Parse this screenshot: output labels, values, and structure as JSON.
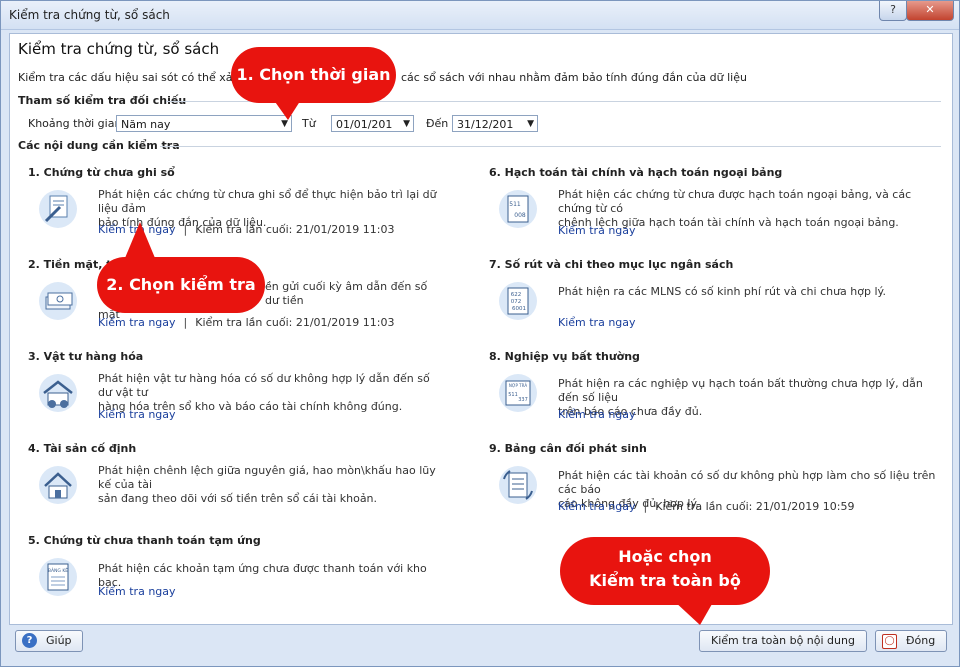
{
  "window": {
    "title": "Kiểm tra chứng từ, sổ sách",
    "help_glyph": "?",
    "close_glyph": "✕"
  },
  "header": {
    "title": "Kiểm tra chứng từ, sổ sách",
    "description_left": "Kiểm tra các dấu hiệu sai sót có thể xảy ra trong",
    "description_right": "các sổ sách với nhau nhằm đảm bảo tính đúng đắn của dữ liệu"
  },
  "params": {
    "section_title": "Tham số kiểm tra đối chiếu",
    "period_label": "Khoảng thời gian",
    "period_value": "Năm nay",
    "from_label": "Từ",
    "from_value": "01/01/201",
    "to_label": "Đến",
    "to_value": "31/12/201"
  },
  "content": {
    "section_title": "Các nội dung cần kiểm tra",
    "check_now": "Kiểm tra ngay",
    "items": [
      {
        "title": "1. Chứng từ chưa ghi sổ",
        "desc1": "Phát hiện các chứng từ chưa ghi sổ để thực hiện bảo trì lại dữ liệu đảm",
        "desc2": "bảo tính đúng đắn của dữ liệu.",
        "last_check": "Kiểm tra lần cuối: 21/01/2019 11:03",
        "icon": "document-pen-icon"
      },
      {
        "title": "2. Tiền mặt, tiề",
        "desc1": "ền gửi cuối kỳ âm dẫn đến số dư tiền",
        "desc2": "mặt",
        "last_check": "Kiểm tra lần cuối: 21/01/2019 11:03",
        "icon": "cash-icon"
      },
      {
        "title": "3. Vật tư hàng hóa",
        "desc1": "Phát hiện vật tư hàng hóa có số dư không hợp lý dẫn đến số dư vật tư",
        "desc2": "hàng hóa trên sổ kho và báo cáo tài chính không đúng.",
        "last_check": "",
        "icon": "warehouse-icon"
      },
      {
        "title": "4. Tài sản cố định",
        "desc1": "Phát hiện chênh lệch giữa nguyên giá, hao mòn\\khấu hao lũy kế của tài",
        "desc2": "sản đang theo dõi với số tiền trên sổ cái tài khoản.",
        "last_check": "",
        "icon": "house-icon"
      },
      {
        "title": "5. Chứng từ chưa thanh toán tạm ứng",
        "desc1": "Phát hiện các khoản tạm ứng chưa được thanh toán với kho bạc.",
        "desc2": "",
        "last_check": "",
        "icon": "report-icon"
      },
      {
        "title": "6. Hạch toán tài chính và hạch toán ngoại bảng",
        "desc1": "Phát hiện các chứng từ chưa được hạch toán ngoại bảng, và các chứng từ có",
        "desc2": "chênh lệch giữa hạch toán tài chính và hạch toán ngoại bảng.",
        "last_check": "",
        "icon": "ledger-icon",
        "icon_text": [
          "511",
          "008"
        ]
      },
      {
        "title": "7. Số rút và chi theo mục lục ngân sách",
        "desc1": "Phát hiện ra các MLNS có số kinh phí rút và chi chưa hợp lý.",
        "desc2": "",
        "last_check": "",
        "icon": "budget-icon",
        "icon_text": [
          "622",
          "072",
          "6001"
        ]
      },
      {
        "title": "8. Nghiệp vụ bất thường",
        "desc1": "Phát hiện ra các nghiệp vụ hạch toán bất thường chưa hợp lý, dẫn đến số liệu",
        "desc2": "trên báo cáo chưa đầy đủ.",
        "last_check": "",
        "icon": "anomaly-icon",
        "icon_text": [
          "NỢP TRẢ",
          "511",
          "337"
        ]
      },
      {
        "title": "9. Bảng cân đối phát sinh",
        "desc1": "Phát hiện các tài khoản có số dư không phù hợp làm cho số liệu trên các báo",
        "desc2": "cáo không đầy đủ, hợp lý.",
        "last_check": "Kiểm tra lần cuối: 21/01/2019 10:59",
        "icon": "balance-sheet-icon"
      }
    ],
    "report_icon_text": "BẢNG KÊ"
  },
  "callouts": {
    "step1": "1. Chọn thời gian",
    "step2": "2. Chọn kiểm tra",
    "step3_line1": "Hoặc chọn",
    "step3_line2": "Kiểm tra toàn bộ"
  },
  "footer": {
    "help_label": "Giúp",
    "check_all_label": "Kiểm tra toàn bộ nội dung",
    "close_label": "Đóng"
  },
  "colors": {
    "callout": "#e8140f",
    "link": "#1a3f9c",
    "icon_bg": "#dbe8f7"
  }
}
